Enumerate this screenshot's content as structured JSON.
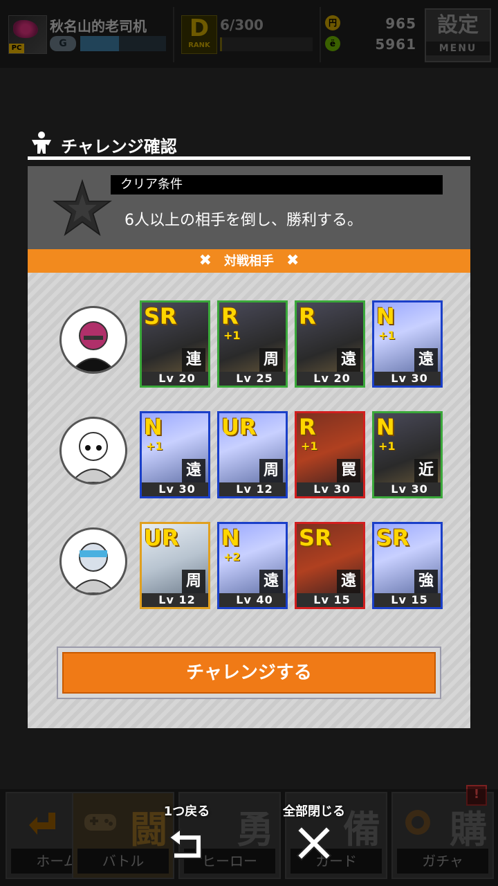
{
  "header": {
    "player_name": "秋名山的老司机",
    "player_tag": "PC",
    "rank_letter": "G",
    "rank_progress": 0.45,
    "rank_icon_big": "D",
    "rank_icon_small": "RANK",
    "stamina": "6/300",
    "stamina_progress": 0.02,
    "coin_label": "円",
    "coins": "965",
    "gem_label": "ё",
    "gems": "5961",
    "menu_kanji": "設定",
    "menu_label": "MENU"
  },
  "dialog": {
    "title": "チャレンジ確認",
    "condition_label": "クリア条件",
    "condition_text": "6人以上の相手を倒し、勝利する。",
    "opponents_label": "対戦相手",
    "challenge_button": "チャレンジする",
    "opponents": [
      {
        "avatar": "pink-haired-glasses-man",
        "cards": [
          {
            "rarity": "SR",
            "plus": "",
            "type": "連",
            "level": "Lv 20",
            "frame": "#3aa83a"
          },
          {
            "rarity": "R",
            "plus": "+1",
            "type": "周",
            "level": "Lv 25",
            "frame": "#3aa83a"
          },
          {
            "rarity": "R",
            "plus": "",
            "type": "遠",
            "level": "Lv 20",
            "frame": "#3aa83a"
          },
          {
            "rarity": "N",
            "plus": "+1",
            "type": "遠",
            "level": "Lv 30",
            "frame": "#1a3fc8"
          }
        ]
      },
      {
        "avatar": "white-robot",
        "cards": [
          {
            "rarity": "N",
            "plus": "+1",
            "type": "遠",
            "level": "Lv 30",
            "frame": "#1a3fc8"
          },
          {
            "rarity": "UR",
            "plus": "",
            "type": "周",
            "level": "Lv 12",
            "frame": "#1a3fc8"
          },
          {
            "rarity": "R",
            "plus": "+1",
            "type": "罠",
            "level": "Lv 30",
            "frame": "#d21e1e"
          },
          {
            "rarity": "N",
            "plus": "+1",
            "type": "近",
            "level": "Lv 30",
            "frame": "#3aa83a"
          }
        ]
      },
      {
        "avatar": "visor-robot",
        "cards": [
          {
            "rarity": "UR",
            "plus": "",
            "type": "周",
            "level": "Lv 12",
            "frame": "#e0a020"
          },
          {
            "rarity": "N",
            "plus": "+2",
            "type": "遠",
            "level": "Lv 40",
            "frame": "#1a3fc8"
          },
          {
            "rarity": "SR",
            "plus": "",
            "type": "遠",
            "level": "Lv 15",
            "frame": "#d21e1e"
          },
          {
            "rarity": "SR",
            "plus": "",
            "type": "強",
            "level": "Lv 15",
            "frame": "#1a3fc8"
          }
        ]
      }
    ]
  },
  "nav": {
    "items": [
      {
        "big": "",
        "label": "ホーム"
      },
      {
        "big": "闘",
        "label": "バトル"
      },
      {
        "big": "勇",
        "label": "ヒーロー"
      },
      {
        "big": "備",
        "label": "カード"
      },
      {
        "big": "購",
        "label": "ガチャ"
      }
    ],
    "back_label": "1つ戻る",
    "close_all_label": "全部閉じる",
    "badge": "!"
  }
}
